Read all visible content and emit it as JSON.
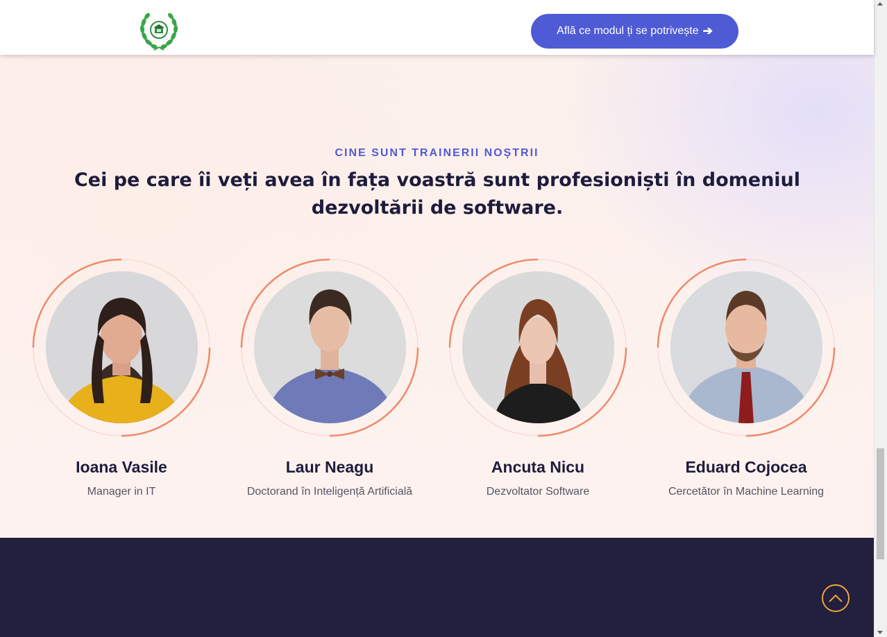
{
  "header": {
    "logo_icon": "laurel-wreath-logo-icon",
    "cta_label": "Află ce modul ți se potrivește",
    "cta_icon": "arrow-right-icon",
    "accent_color": "#4f5bd5"
  },
  "section": {
    "eyebrow": "CINE SUNT TRAINERII NOȘTRII",
    "title": "Cei pe care îi veți avea în fața voastră sunt profesioniști în domeniul dezvoltării de software."
  },
  "trainers": [
    {
      "name": "Ioana Vasile",
      "role": "Manager in IT"
    },
    {
      "name": "Laur Neagu",
      "role": "Doctorand în Inteligență Artificială"
    },
    {
      "name": "Ancuta Nicu",
      "role": "Dezvoltator Software"
    },
    {
      "name": "Eduard Cojocea",
      "role": "Cercetător în Machine Learning"
    }
  ],
  "colors": {
    "ring": "#ee8a6a",
    "footer": "#221f3f",
    "back_to_top": "#f0a53a",
    "title": "#1e1c3c"
  },
  "back_to_top_icon": "chevron-up-icon"
}
